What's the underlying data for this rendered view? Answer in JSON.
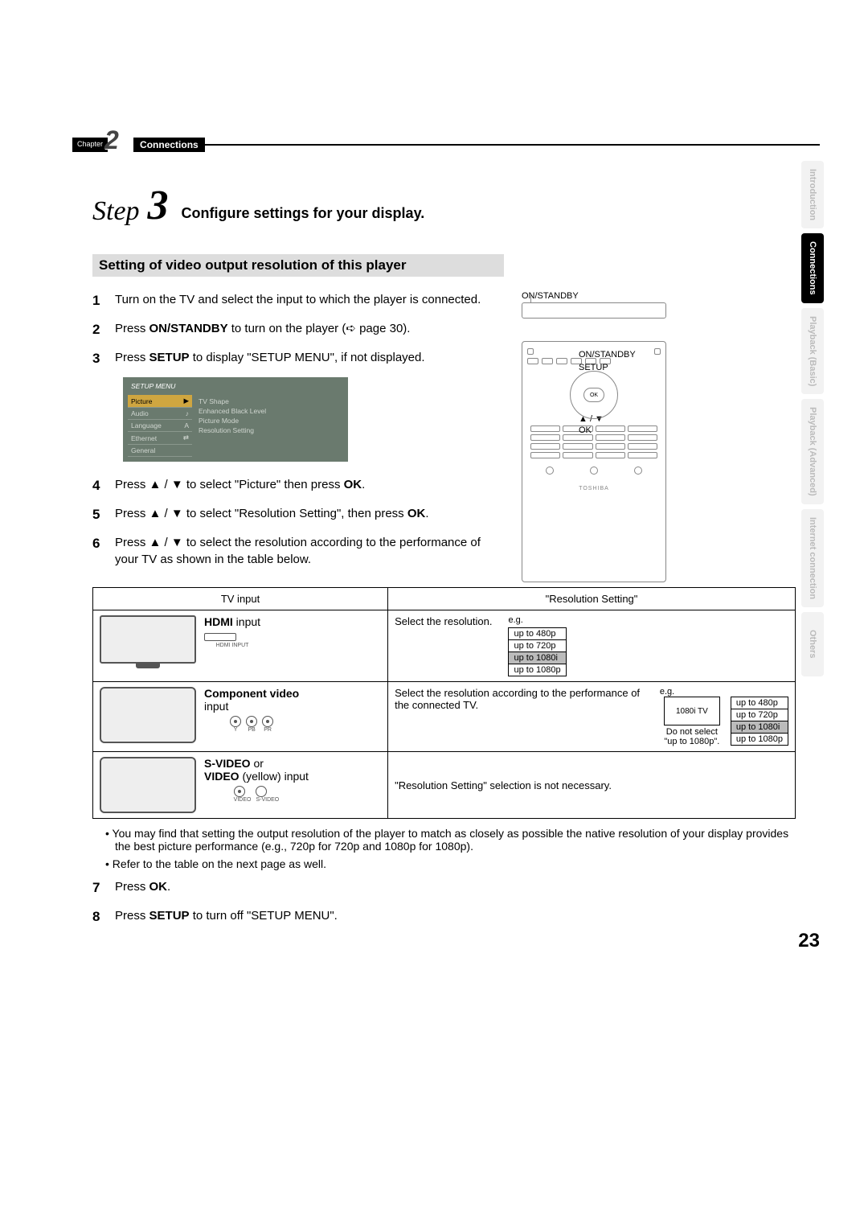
{
  "chapter": {
    "label": "Chapter",
    "number": "2",
    "title": "Connections"
  },
  "side_tabs": [
    {
      "label": "Introduction",
      "active": false
    },
    {
      "label": "Connections",
      "active": true
    },
    {
      "label": "Playback (Basic)",
      "active": false
    },
    {
      "label": "Playback (Advanced)",
      "active": false
    },
    {
      "label": "Internet connection",
      "active": false
    },
    {
      "label": "Others",
      "active": false
    }
  ],
  "step_header": {
    "word": "Step",
    "number": "3",
    "title": "Configure settings for your display."
  },
  "section_title": "Setting of video output resolution of this player",
  "steps": [
    {
      "n": "1",
      "text_pre": "Turn on the TV and select the input to which the player is connected."
    },
    {
      "n": "2",
      "text_pre": "Press ",
      "b1": "ON/STANDBY",
      "text_mid": " to turn on the player (",
      "ref": "➪ page 30",
      "text_post": ")."
    },
    {
      "n": "3",
      "text_pre": "Press ",
      "b1": "SETUP",
      "text_post": " to display \"SETUP MENU\", if not displayed."
    },
    {
      "n": "4",
      "text_pre": "Press ▲ / ▼ to select \"Picture\" then press ",
      "b1": "OK",
      "text_post": "."
    },
    {
      "n": "5",
      "text_pre": "Press ▲ / ▼ to select \"Resolution Setting\", then press ",
      "b1": "OK",
      "text_post": "."
    },
    {
      "n": "6",
      "text_pre": "Press ▲ / ▼ to select the resolution according to the performance of your TV as shown in the table below."
    },
    {
      "n": "7",
      "text_pre": "Press ",
      "b1": "OK",
      "text_post": "."
    },
    {
      "n": "8",
      "text_pre": "Press ",
      "b1": "SETUP",
      "text_post": " to turn off \"SETUP MENU\"."
    }
  ],
  "setup_menu": {
    "title": "SETUP MENU",
    "left": [
      "Picture",
      "Audio",
      "Language",
      "Ethernet",
      "General"
    ],
    "right": [
      "TV Shape",
      "Enhanced Black Level",
      "Picture Mode",
      "Resolution Setting"
    ]
  },
  "remote": {
    "top_label": "ON/STANDBY",
    "callouts": {
      "onstandby": "ON/STANDBY",
      "setup": "SETUP",
      "arrows": "▲ / ▼",
      "ok": "OK"
    },
    "ok_btn": "OK",
    "logo": "TOSHIBA"
  },
  "table": {
    "head": {
      "col1": "TV input",
      "col2": "\"Resolution Setting\""
    },
    "row1": {
      "input_label_b": "HDMI",
      "input_label_rest": " input",
      "port_label": "HDMI INPUT",
      "right_text": "Select the resolution.",
      "eg": "e.g.",
      "options": [
        "up to 480p",
        "up to 720p",
        "up to 1080i",
        "up to 1080p"
      ],
      "selected_index": 2
    },
    "row2": {
      "input_label_b": "Component video",
      "input_label_rest": "input",
      "port_labels": [
        "Y",
        "PB",
        "PR"
      ],
      "right_text": "Select the resolution according to the performance of the connected TV.",
      "eg": "e.g.",
      "mini_tv": "1080i TV",
      "note": "Do not select \"up to 1080p\".",
      "options": [
        "up to 480p",
        "up to 720p",
        "up to 1080i",
        "up to 1080p"
      ],
      "selected_index": 2
    },
    "row3": {
      "input_label_b1": "S-VIDEO",
      "입력_or": " or",
      "input_label_b2": "VIDEO",
      "input_label_rest": " (yellow) input",
      "port_labels": [
        "VIDEO",
        "S-VIDEO"
      ],
      "right_text": "\"Resolution Setting\" selection is not necessary."
    }
  },
  "bullets": [
    "You may find that setting the output resolution of the player to match as closely as possible the native resolution of your display provides the best picture performance (e.g., 720p for 720p and 1080p for 1080p).",
    "Refer to the table on the next page as well."
  ],
  "page_num": "23"
}
